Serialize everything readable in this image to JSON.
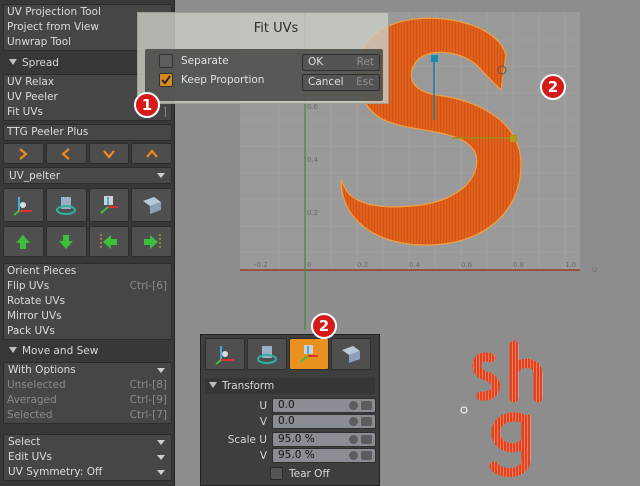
{
  "left_panel": {
    "group_projection": [
      "UV Projection Tool",
      "Project from View",
      "Unwrap Tool"
    ],
    "spread_header": "Spread",
    "group_relax": [
      {
        "label": "UV Relax",
        "shortcut": ""
      },
      {
        "label": "UV Peeler",
        "shortcut": ""
      },
      {
        "label": "Fit UVs",
        "shortcut": "]"
      }
    ],
    "ttg_label": "TTG Peeler Plus",
    "arrow_buttons": [
      "right-chevron-icon",
      "left-chevron-icon",
      "down-chevron-icon",
      "up-chevron-icon"
    ],
    "uv_pelter_dropdown": "UV_pelter",
    "tool_icons": [
      "transform-icon",
      "rotate-icon",
      "scale-icon",
      "shear-icon"
    ],
    "move_icons": [
      "move-up-icon",
      "move-down-icon",
      "move-left-icon",
      "move-right-icon"
    ],
    "group_orient": [
      {
        "label": "Orient Pieces",
        "shortcut": ""
      },
      {
        "label": "Flip UVs",
        "shortcut": "Ctrl-[6]"
      },
      {
        "label": "Rotate UVs",
        "shortcut": ""
      },
      {
        "label": "Mirror UVs",
        "shortcut": ""
      },
      {
        "label": "Pack UVs",
        "shortcut": ""
      }
    ],
    "move_sew_header": "Move and Sew",
    "with_options": "With Options",
    "group_selection_state": [
      {
        "label": "Unselected",
        "shortcut": "Ctrl-[8]"
      },
      {
        "label": "Averaged",
        "shortcut": "Ctrl-[9]"
      },
      {
        "label": "Selected",
        "shortcut": "Ctrl-[7]"
      }
    ],
    "bottom_dropdowns": [
      "Select",
      "Edit UVs",
      "UV Symmetry: Off"
    ]
  },
  "fit_dialog": {
    "title": "Fit UVs",
    "separate_label": "Separate",
    "separate_checked": false,
    "keep_proportion_label": "Keep Proportion",
    "keep_proportion_checked": true,
    "ok_label": "OK",
    "ok_shortcut": "Ret",
    "cancel_label": "Cancel",
    "cancel_shortcut": "Esc"
  },
  "viewport": {
    "x_ticks": [
      "-0.2",
      "0",
      "0.2",
      "0.4",
      "0.6",
      "0.8",
      "1.0"
    ],
    "y_ticks": [
      "0.6",
      "0.4",
      "0.2"
    ],
    "axis_u_label": "U",
    "uv_accent_color": "#e05a1a"
  },
  "transform_panel": {
    "tool_icons": [
      "transform-icon",
      "rotate-icon",
      "scale-icon",
      "shear-icon"
    ],
    "active_index": 2,
    "section_title": "Transform",
    "position_u_label": "U",
    "position_u_value": "0.0",
    "position_v_label": "V",
    "position_v_value": "0.0",
    "scale_u_label": "Scale U",
    "scale_u_value": "95.0 %",
    "scale_v_label": "V",
    "scale_v_value": "95.0 %",
    "tear_off_label": "Tear Off"
  },
  "badges": {
    "fit_badge": "1",
    "viewport_badge": "2",
    "panel_badge": "2"
  }
}
